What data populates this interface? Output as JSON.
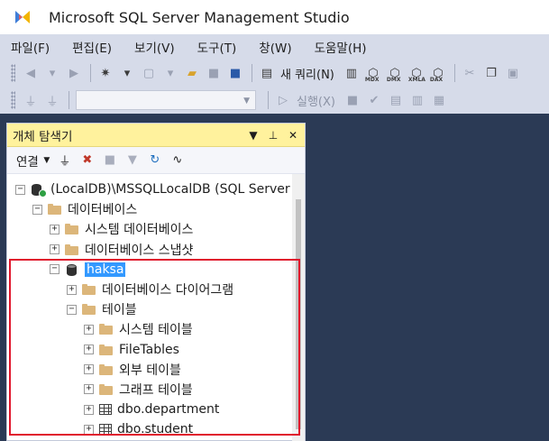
{
  "app": {
    "title": "Microsoft SQL Server Management Studio"
  },
  "menu": [
    "파일(F)",
    "편집(E)",
    "보기(V)",
    "도구(T)",
    "창(W)",
    "도움말(H)"
  ],
  "toolbar": {
    "new_query": "새 쿼리(N)",
    "execute": "실행(X)",
    "mdx": "MDX",
    "dmx": "DMX",
    "xmla": "XMLA",
    "dax": "DAX"
  },
  "object_explorer": {
    "title": "개체 탐색기",
    "connect_label": "연결",
    "pin_glyph": "▼",
    "tree": {
      "server": "(LocalDB)\\MSSQLLocalDB (SQL Server",
      "databases": "데이터베이스",
      "system_databases": "시스템 데이터베이스",
      "db_snapshots": "데이터베이스 스냅샷",
      "db_name": "haksa",
      "db_diagrams": "데이터베이스 다이어그램",
      "tables": "테이블",
      "system_tables": "시스템 테이블",
      "file_tables": "FileTables",
      "external_tables": "외부 테이블",
      "graph_tables": "그래프 테이블",
      "table_1": "dbo.department",
      "table_2": "dbo.student"
    }
  },
  "colors": {
    "accent": "#fff29d",
    "selection": "#3399ff",
    "highlight": "#e0182d",
    "background": "#2b3a55"
  }
}
